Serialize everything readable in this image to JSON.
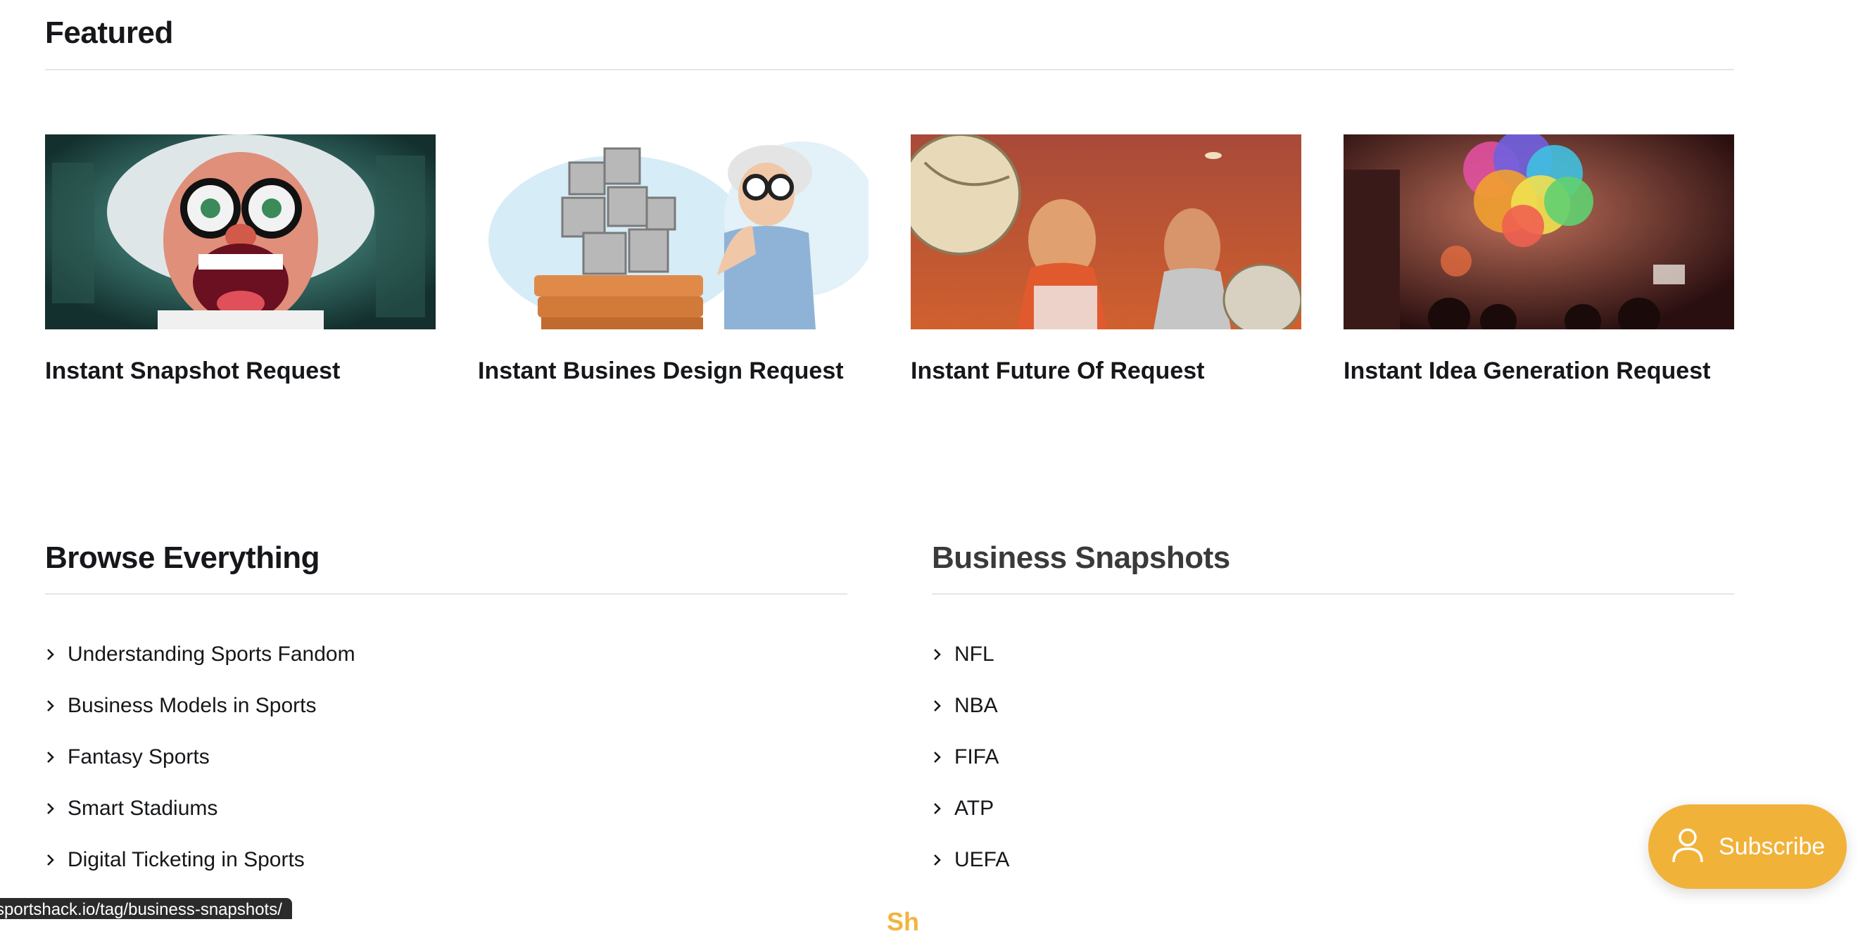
{
  "featured": {
    "title": "Featured",
    "cards": [
      {
        "title": "Instant Snapshot Request"
      },
      {
        "title": "Instant Busines Design Request"
      },
      {
        "title": "Instant Future Of Request"
      },
      {
        "title": "Instant Idea Generation Request"
      }
    ]
  },
  "browse": {
    "title": "Browse Everything",
    "items": [
      {
        "label": "Understanding Sports Fandom"
      },
      {
        "label": "Business Models in Sports"
      },
      {
        "label": "Fantasy Sports"
      },
      {
        "label": "Smart Stadiums"
      },
      {
        "label": "Digital Ticketing in Sports"
      }
    ]
  },
  "snapshots": {
    "title": "Business Snapshots",
    "items": [
      {
        "label": "NFL"
      },
      {
        "label": "NBA"
      },
      {
        "label": "FIFA"
      },
      {
        "label": "ATP"
      },
      {
        "label": "UEFA"
      }
    ],
    "next_heading_peek": "Sh"
  },
  "status_bar": {
    "url": "sportshack.io/tag/business-snapshots/"
  },
  "subscribe": {
    "label": "Subscribe",
    "icon": "user-icon",
    "color": "#f1b23a"
  },
  "colors": {
    "text": "#15171a",
    "accent": "#f1b23a",
    "rule": "#e6e6e6"
  }
}
